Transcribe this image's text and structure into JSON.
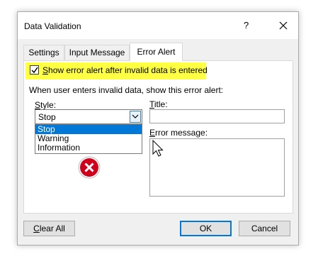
{
  "dialog": {
    "title": "Data Validation",
    "help_label": "?"
  },
  "tabs": [
    {
      "label": "Settings"
    },
    {
      "label": "Input Message"
    },
    {
      "label": "Error Alert"
    }
  ],
  "show_alert": {
    "checked": true,
    "label_underlined": "S",
    "label_rest": "how error alert after invalid data is entered"
  },
  "section_label": "When user enters invalid data, show this error alert:",
  "style": {
    "label_underlined": "S",
    "label_rest": "tyle:",
    "value": "Stop",
    "options": [
      "Stop",
      "Warning",
      "Information"
    ]
  },
  "title_field": {
    "label_underlined": "T",
    "label_rest": "itle:",
    "value": ""
  },
  "error_message": {
    "label_underlined": "E",
    "label_rest": "rror message:",
    "value": ""
  },
  "buttons": {
    "clear_all_underlined": "C",
    "clear_all_rest": "lear All",
    "ok": "OK",
    "cancel": "Cancel"
  },
  "colors": {
    "highlight": "#ffff44",
    "selection": "#0078d7",
    "error_icon": "#d0021b"
  },
  "icons": {
    "error": "error-x-circle-icon",
    "close": "close-icon",
    "dropdown": "chevron-down-icon",
    "cursor": "mouse-pointer-icon"
  }
}
